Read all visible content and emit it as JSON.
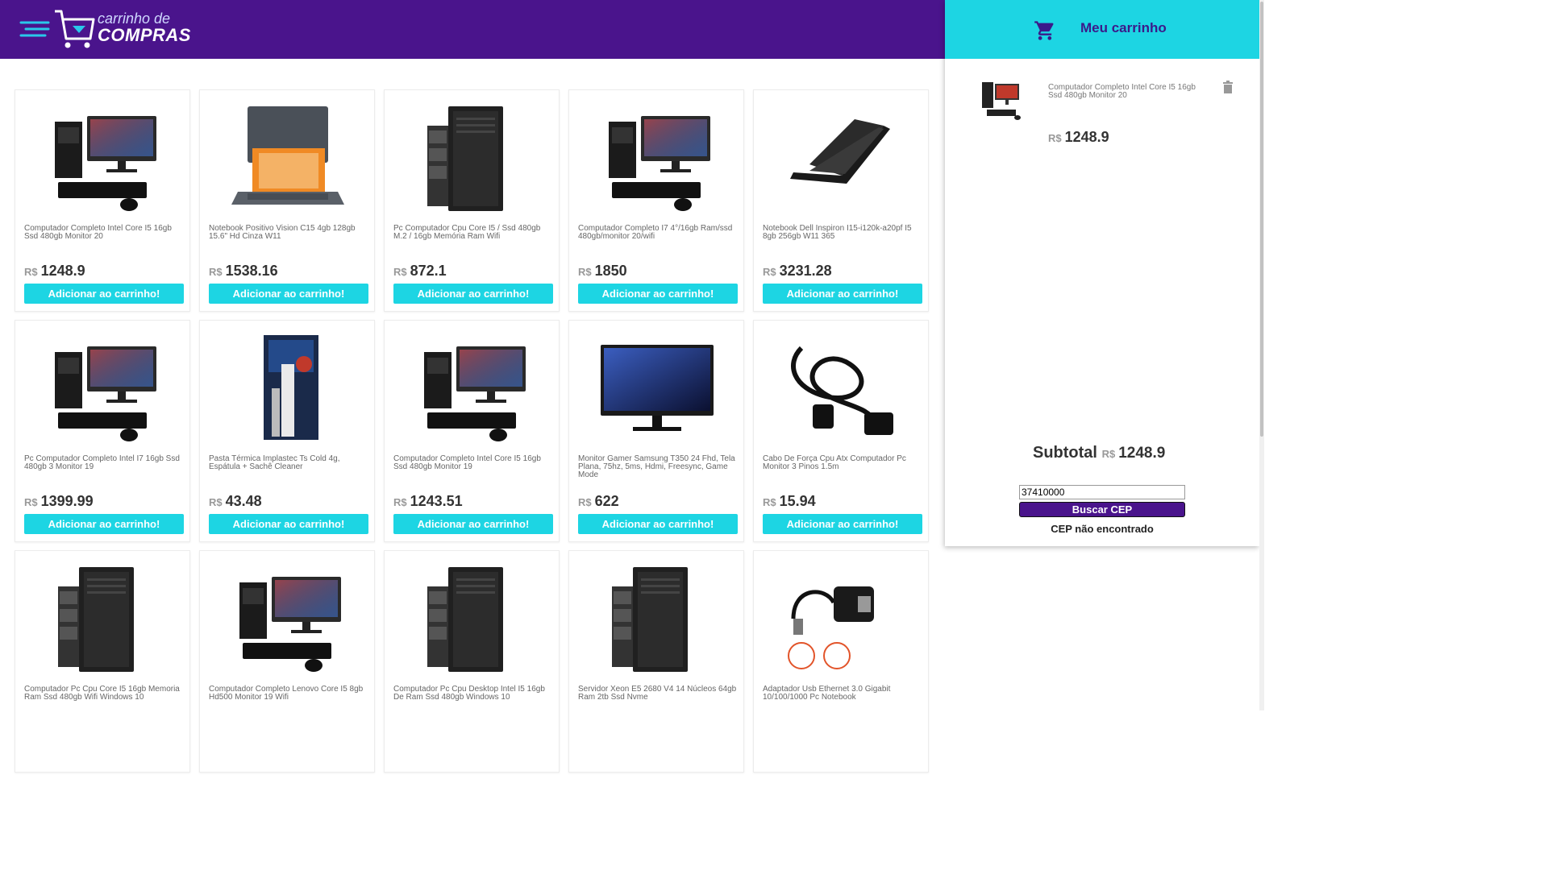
{
  "header": {
    "logo_line1": "carrinho de",
    "logo_line2": "COMPRAS"
  },
  "colors": {
    "header_bg": "#4a148c",
    "accent": "#1dd5e3"
  },
  "currency": "R$",
  "add_button_label": "Adicionar ao carrinho!",
  "products": [
    {
      "title": "Computador Completo Intel Core I5 16gb Ssd 480gb Monitor 20",
      "price": "1248.9",
      "image": "pc-monitor"
    },
    {
      "title": "Notebook Positivo Vision C15 4gb 128gb 15.6\" Hd Cinza W11",
      "price": "1538.16",
      "image": "laptop-positivo"
    },
    {
      "title": "Pc Computador Cpu Core I5 / Ssd 480gb M.2 / 16gb Memória Ram Wifi",
      "price": "872.1",
      "image": "tower"
    },
    {
      "title": "Computador Completo I7 4°/16gb Ram/ssd 480gb/monitor 20/wifi",
      "price": "1850",
      "image": "pc-monitor"
    },
    {
      "title": "Notebook Dell Inspiron I15-i120k-a20pf I5 8gb 256gb W11 365",
      "price": "3231.28",
      "image": "laptop-dell"
    },
    {
      "title": "Pc Computador Completo Intel I7 16gb Ssd 480gb 3 Monitor 19",
      "price": "1399.99",
      "image": "pc-monitor"
    },
    {
      "title": "Pasta Térmica Implastec Ts Cold 4g, Espátula + Sachê Cleaner",
      "price": "43.48",
      "image": "thermal-paste"
    },
    {
      "title": "Computador Completo Intel Core I5 16gb Ssd 480gb Monitor 19",
      "price": "1243.51",
      "image": "pc-monitor"
    },
    {
      "title": "Monitor Gamer Samsung T350 24 Fhd, Tela Plana, 75hz, 5ms, Hdmi, Freesync, Game Mode",
      "price": "622",
      "image": "monitor"
    },
    {
      "title": "Cabo De Força Cpu Atx Computador Pc Monitor 3 Pinos 1.5m",
      "price": "15.94",
      "image": "cable"
    },
    {
      "title": "Computador Pc Cpu Core I5 16gb Memoria Ram Ssd 480gb Wifi Windows 10",
      "price": "",
      "image": "tower"
    },
    {
      "title": "Computador Completo Lenovo Core I5 8gb Hd500 Monitor 19 Wifi",
      "price": "",
      "image": "pc-monitor"
    },
    {
      "title": "Computador Pc Cpu Desktop Intel I5 16gb De Ram Ssd 480gb Windows 10",
      "price": "",
      "image": "tower"
    },
    {
      "title": "Servidor Xeon E5 2680 V4 14 Núcleos 64gb Ram 2tb Ssd Nvme",
      "price": "",
      "image": "tower"
    },
    {
      "title": "Adaptador Usb Ethernet 3.0 Gigabit 10/100/1000 Pc Notebook",
      "price": "",
      "image": "usb-adapter"
    }
  ],
  "cart": {
    "title": "Meu carrinho",
    "item": {
      "title": "Computador Completo Intel Core I5 16gb Ssd 480gb Monitor 20",
      "price": "1248.9"
    },
    "subtotal_label": "Subtotal",
    "subtotal_value": "1248.9",
    "cep_value": "37410000",
    "cep_button": "Buscar CEP",
    "cep_message": "CEP não encontrado"
  }
}
